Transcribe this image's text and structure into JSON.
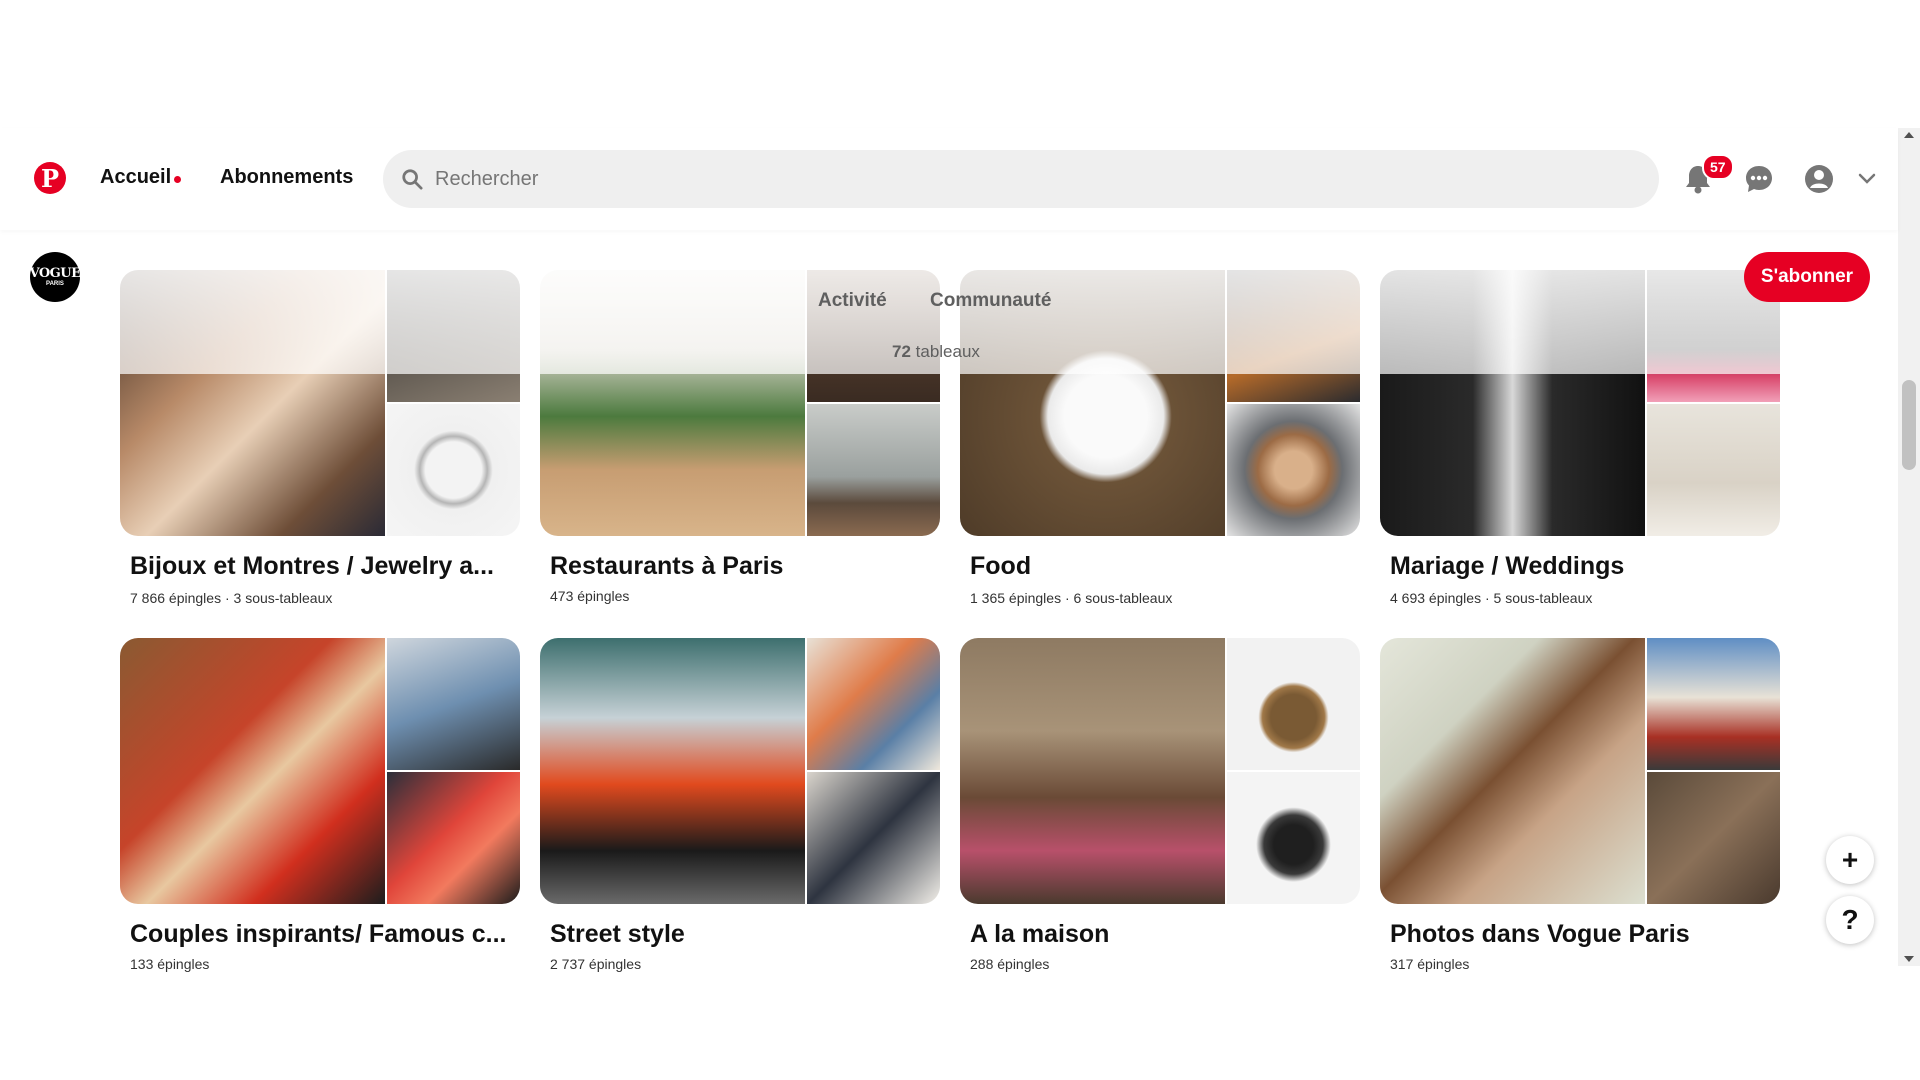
{
  "header": {
    "logo_glyph": "P",
    "nav": {
      "home": "Accueil",
      "following": "Abonnements"
    },
    "search_placeholder": "Rechercher",
    "notifications_count": "57"
  },
  "profile": {
    "avatar_line1": "VOGUE",
    "avatar_line2": "PARIS",
    "subscribe_label": "S'abonner",
    "tabs": {
      "activity": "Activité",
      "community": "Communauté"
    },
    "board_count_number": "72",
    "board_count_suffix": " tableaux"
  },
  "boards": [
    {
      "title": "Bijoux et Montres / Jewelry a...",
      "meta": "7 866 épingles · 3 sous-tableaux"
    },
    {
      "title": "Restaurants à Paris",
      "meta": "473 épingles"
    },
    {
      "title": "Food",
      "meta": "1 365 épingles · 6 sous-tableaux"
    },
    {
      "title": "Mariage / Weddings",
      "meta": "4 693 épingles · 5 sous-tableaux"
    },
    {
      "title": "Couples inspirants/ Famous c...",
      "meta": "133 épingles"
    },
    {
      "title": "Street style",
      "meta": "2 737 épingles"
    },
    {
      "title": "A la maison",
      "meta": "288 épingles"
    },
    {
      "title": "Photos dans Vogue Paris",
      "meta": "317 épingles"
    }
  ],
  "floating": {
    "add": "+",
    "help": "?"
  },
  "colors": {
    "brand": "#e60023",
    "search_bg": "#efefef"
  }
}
